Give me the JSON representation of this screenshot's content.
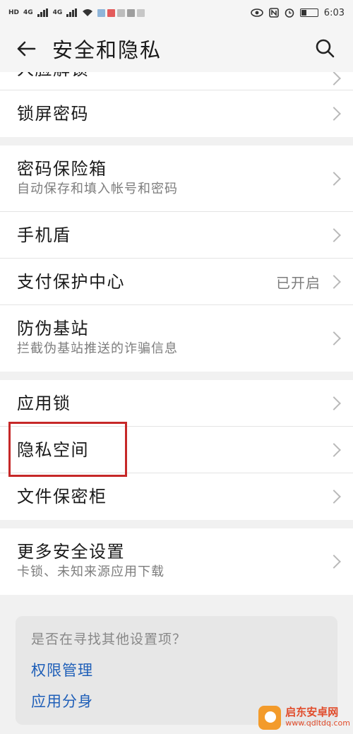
{
  "status_bar": {
    "hd": "HD",
    "net1": "4G",
    "net2": "4G",
    "time": "6:03",
    "battery_level": 0.35
  },
  "header": {
    "title": "安全和隐私"
  },
  "partial_row": {
    "label": "人脸解锁"
  },
  "group1": [
    {
      "label": "锁屏密码"
    }
  ],
  "group2": [
    {
      "label": "密码保险箱",
      "subtitle": "自动保存和填入帐号和密码"
    },
    {
      "label": "手机盾"
    },
    {
      "label": "支付保护中心",
      "value": "已开启"
    },
    {
      "label": "防伪基站",
      "subtitle": "拦截伪基站推送的诈骗信息"
    }
  ],
  "group3": [
    {
      "label": "应用锁"
    },
    {
      "label": "隐私空间"
    },
    {
      "label": "文件保密柜"
    }
  ],
  "group4": [
    {
      "label": "更多安全设置",
      "subtitle": "卡锁、未知来源应用下载"
    }
  ],
  "hint": {
    "question": "是否在寻找其他设置项？",
    "links": [
      "权限管理",
      "应用分身"
    ]
  },
  "watermark": {
    "brand": "启东安卓网",
    "url": "www.qdltdq.com"
  },
  "colors": {
    "link": "#1f5fb8",
    "highlight": "#c62828"
  }
}
